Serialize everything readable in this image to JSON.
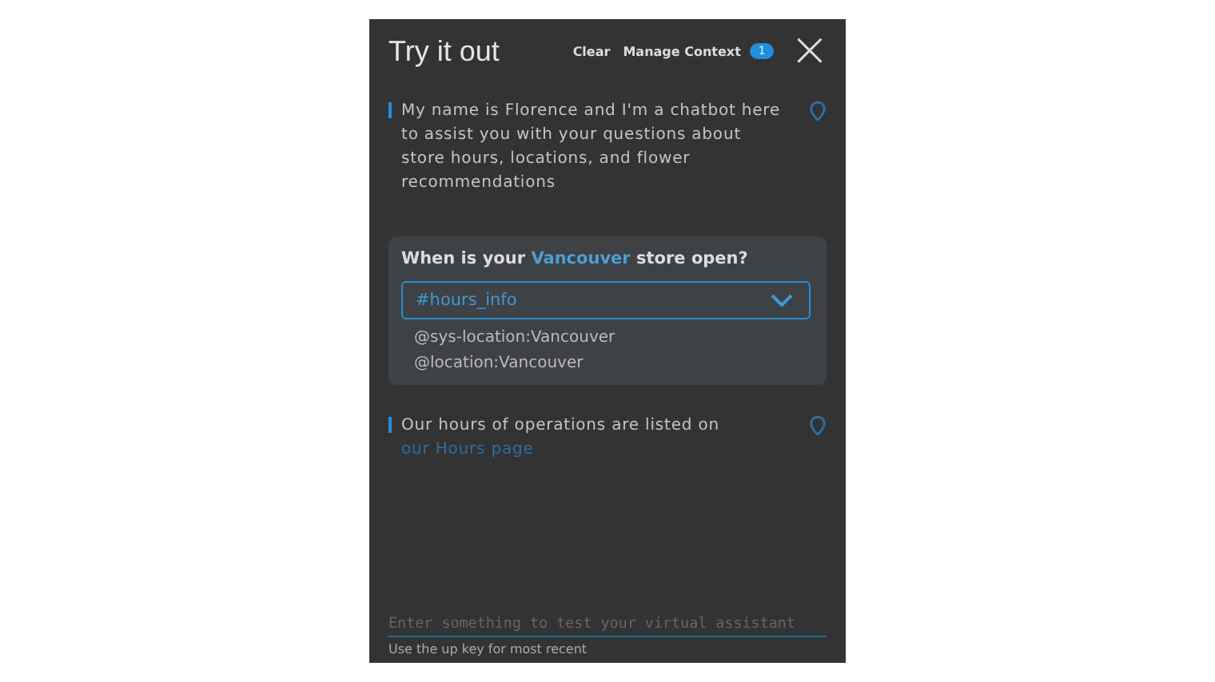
{
  "header": {
    "title": "Try it out",
    "clear": "Clear",
    "manage_context": "Manage Context",
    "context_count": "1",
    "close": "×"
  },
  "messages": [
    {
      "kind": "bot",
      "parts": [
        {
          "kind": "text",
          "text": "My name is Florence and I'm a chatbot here to assist you with your questions about store hours, locations, and flower recommendations"
        }
      ]
    },
    {
      "kind": "user",
      "parts": [
        {
          "kind": "text",
          "text": "When is your "
        },
        {
          "kind": "entity",
          "text": "Vancouver"
        },
        {
          "kind": "text",
          "text": " store open?"
        }
      ],
      "intent": "#hours_info",
      "entities": [
        "@sys-location:Vancouver",
        "@location:Vancouver"
      ]
    },
    {
      "kind": "bot",
      "parts": [
        {
          "kind": "text",
          "text": "Our hours of operations are listed on "
        },
        {
          "kind": "link",
          "text": "our Hours page"
        }
      ]
    }
  ],
  "input": {
    "placeholder": "Enter something to test your virtual assistant",
    "hint": "Use the up key for most recent"
  }
}
